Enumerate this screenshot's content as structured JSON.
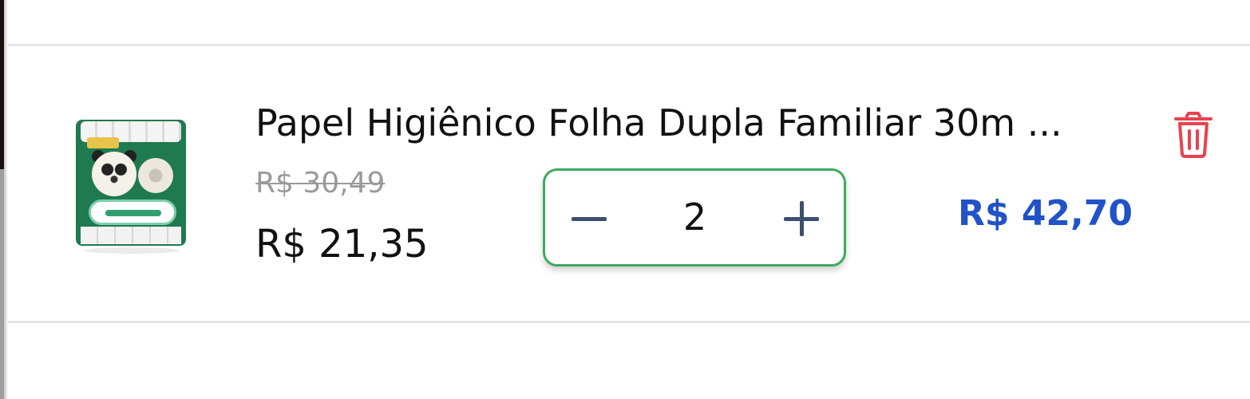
{
  "cart_item": {
    "product_name": "Papel Higiênico Folha Dupla Familiar 30m ...",
    "image_alt": "Papel Higiênico Folha Dupla Familiar 30m",
    "old_price": "R$ 30,49",
    "unit_price": "R$ 21,35",
    "quantity": "2",
    "line_total": "R$ 42,70",
    "decrease_icon": "minus-icon",
    "increase_icon": "plus-icon",
    "delete_icon": "trash-icon"
  },
  "colors": {
    "stepper_border": "#3daa5c",
    "total_price": "#2153c8",
    "delete_icon": "#e8424f",
    "old_price": "#9a9a9a"
  }
}
